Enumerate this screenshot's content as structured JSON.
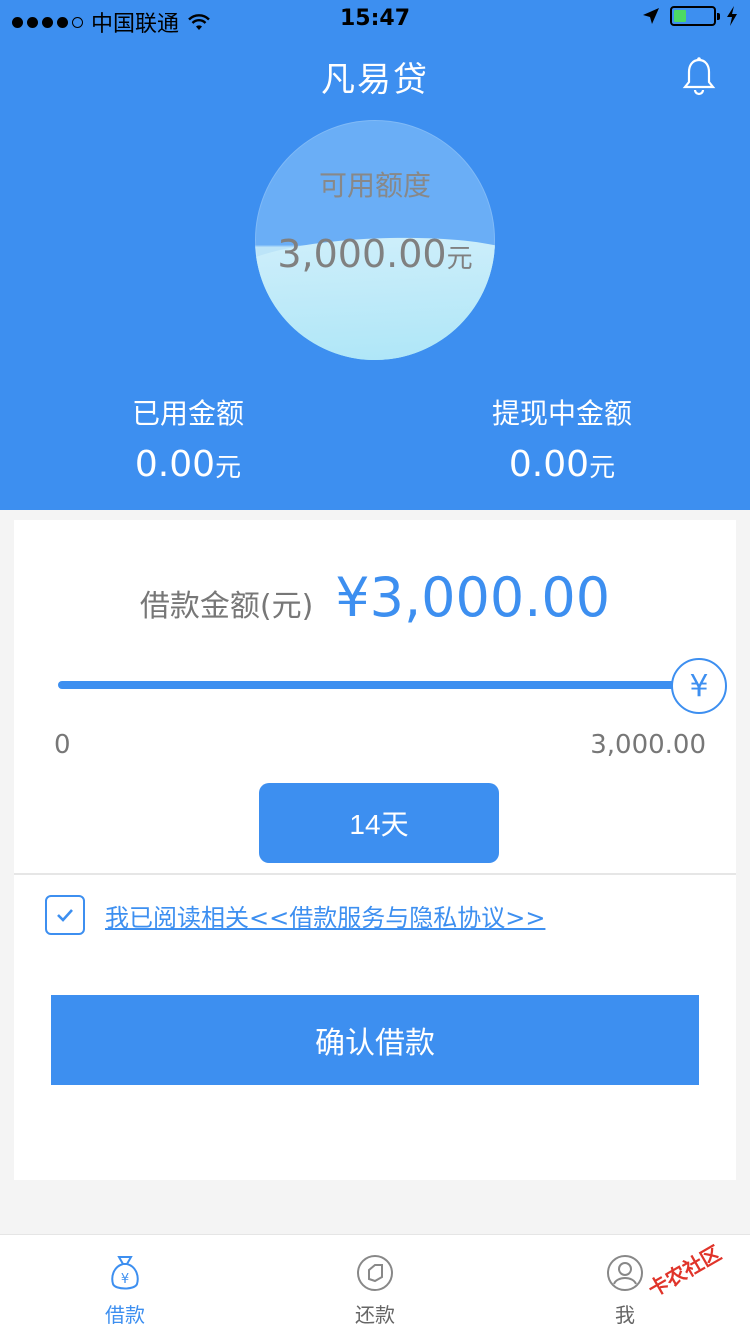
{
  "status_bar": {
    "carrier": "中国联通",
    "time": "15:47"
  },
  "header": {
    "title": "凡易贷",
    "credit_label": "可用额度",
    "credit_amount": "3,000.00",
    "credit_unit": "元",
    "used_label": "已用金额",
    "used_amount": "0.00",
    "used_unit": "元",
    "withdrawing_label": "提现中金额",
    "withdrawing_amount": "0.00",
    "withdrawing_unit": "元"
  },
  "loan": {
    "amount_label": "借款金额(元)",
    "amount_value": "¥3,000.00",
    "slider_symbol": "¥",
    "slider_fraction": 1.0,
    "range_min": "0",
    "range_max": "3,000.00",
    "term_label": "14天",
    "agreement_text": "我已阅读相关<<借款服务与隐私协议>>",
    "agreement_checked": true,
    "confirm_label": "确认借款"
  },
  "tabbar": {
    "tabs": [
      {
        "label": "借款",
        "icon": "money-bag-icon",
        "active": true
      },
      {
        "label": "还款",
        "icon": "repay-icon",
        "active": false
      },
      {
        "label": "我",
        "icon": "user-icon",
        "active": false
      }
    ]
  },
  "watermark": "卡农社区",
  "colors": {
    "primary": "#3d8ff0",
    "background": "#f4f4f4"
  }
}
